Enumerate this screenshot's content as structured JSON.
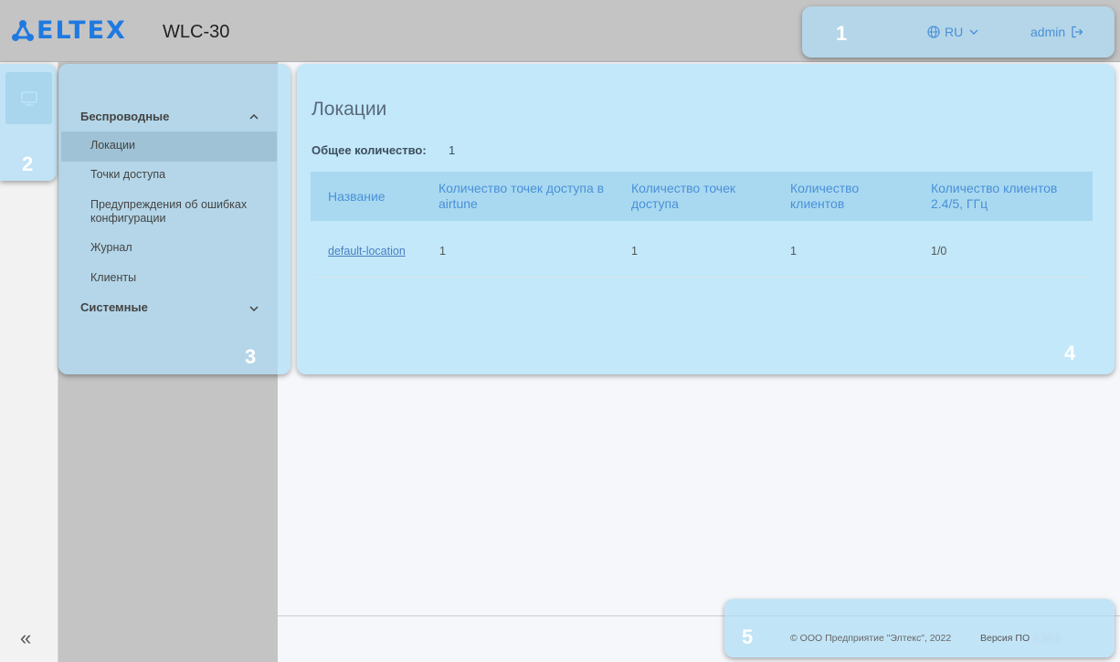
{
  "header": {
    "logo_text": "ELTEX",
    "product": "WLC-30",
    "language": "RU",
    "user": "admin"
  },
  "callouts": [
    "1",
    "2",
    "3",
    "4",
    "5"
  ],
  "sidebar": {
    "groups": [
      {
        "label": "Беспроводные",
        "expanded": true,
        "items": [
          {
            "label": "Локации",
            "active": true
          },
          {
            "label": "Точки доступа",
            "active": false
          },
          {
            "label": "Предупреждения об ошибках конфигурации",
            "active": false
          },
          {
            "label": "Журнал",
            "active": false
          },
          {
            "label": "Клиенты",
            "active": false
          }
        ]
      },
      {
        "label": "Системные",
        "expanded": false,
        "items": []
      }
    ]
  },
  "strip": {
    "collapse": "«"
  },
  "main": {
    "title": "Локации",
    "total_label": "Общее количество:",
    "total_value": "1",
    "table": {
      "headers": [
        "Название",
        "Количество точек доступа в airtune",
        "Количество точек доступа",
        "Количество клиентов",
        "Количество клиентов 2.4/5, ГГц"
      ],
      "rows": [
        [
          "default-location",
          "1",
          "1",
          "1",
          "1/0"
        ]
      ]
    }
  },
  "footer": {
    "copyright": "© ООО Предприятие \"Элтекс\", 2022",
    "version_label": "Версия ПО",
    "version_value": "1.30.0"
  },
  "colors": {
    "accent": "#1f7ae0",
    "link": "#4a90d9",
    "overlay": "#addcf5",
    "header_bg": "#c4c4c4"
  }
}
